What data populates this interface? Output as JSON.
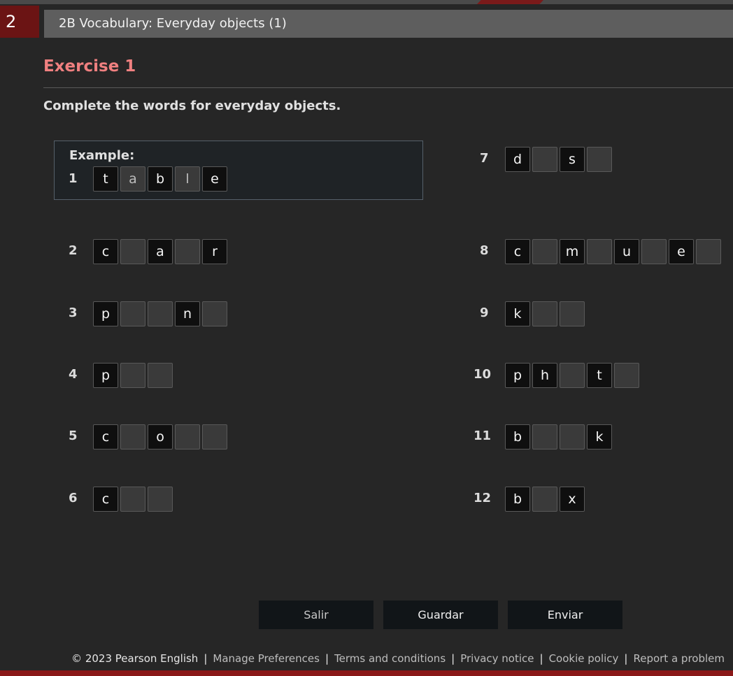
{
  "header": {
    "activity_number": "2",
    "title": "2B Vocabulary: Everyday objects (1)"
  },
  "exercise": {
    "heading": "Exercise 1",
    "instruction": "Complete the words for everyday objects.",
    "example_label": "Example:"
  },
  "items": [
    {
      "number": "1",
      "letters": [
        "t",
        "a",
        "b",
        "l",
        "e"
      ],
      "filled": [
        false,
        true,
        false,
        true,
        false
      ],
      "example": true
    },
    {
      "number": "2",
      "letters": [
        "c",
        "",
        "a",
        "",
        "r"
      ]
    },
    {
      "number": "3",
      "letters": [
        "p",
        "",
        "",
        "n",
        ""
      ]
    },
    {
      "number": "4",
      "letters": [
        "p",
        "",
        ""
      ]
    },
    {
      "number": "5",
      "letters": [
        "c",
        "",
        "o",
        "",
        ""
      ]
    },
    {
      "number": "6",
      "letters": [
        "c",
        "",
        ""
      ]
    },
    {
      "number": "7",
      "letters": [
        "d",
        "",
        "s",
        ""
      ]
    },
    {
      "number": "8",
      "letters": [
        "c",
        "",
        "m",
        "",
        "u",
        "",
        "e",
        ""
      ]
    },
    {
      "number": "9",
      "letters": [
        "k",
        "",
        ""
      ]
    },
    {
      "number": "10",
      "letters": [
        "p",
        "h",
        "",
        "t",
        ""
      ]
    },
    {
      "number": "11",
      "letters": [
        "b",
        "",
        "",
        "k"
      ]
    },
    {
      "number": "12",
      "letters": [
        "b",
        "",
        "x"
      ]
    }
  ],
  "buttons": {
    "exit": "Salir",
    "save": "Guardar",
    "submit": "Enviar"
  },
  "footer": {
    "copyright": "© 2023 Pearson English",
    "links": [
      "Manage Preferences",
      "Terms and conditions",
      "Privacy notice",
      "Cookie policy",
      "Report a problem"
    ]
  },
  "colors": {
    "accent": "#6b1414",
    "heading": "#f08080",
    "background": "#262626"
  }
}
